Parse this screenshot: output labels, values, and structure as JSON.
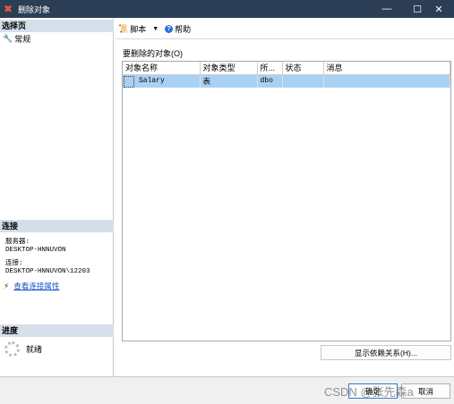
{
  "window": {
    "title": "删除对象",
    "icon": "delete-x-icon",
    "controls": [
      "—",
      "☐",
      "✕"
    ]
  },
  "left": {
    "select_page_header": "选择页",
    "pages": [
      {
        "label": "常规",
        "icon": "wrench-icon"
      }
    ],
    "connection_header": "连接",
    "server_label": "服务器:",
    "server_value": "DESKTOP-HNNUVON",
    "connection_label": "连接:",
    "connection_value": "DESKTOP-HNNUVON\\12203",
    "view_properties_link": "查看连接属性",
    "progress_header": "进度",
    "progress_status": "就绪"
  },
  "toolbar": {
    "script_label": "脚本",
    "help_label": "帮助"
  },
  "main": {
    "section_label": "要删除的对象(O)",
    "columns": [
      "对象名称",
      "对象类型",
      "所...",
      "状态",
      "消息"
    ],
    "rows": [
      {
        "name": "Salary",
        "type": "表",
        "owner": "dbo",
        "status": "",
        "message": ""
      }
    ],
    "show_dependencies_button": "显示依赖关系(H)..."
  },
  "footer": {
    "ok_label": "确定",
    "cancel_label": "取消"
  },
  "watermark": "CSDN @张先森a",
  "colors": {
    "titlebar": "#2c3e55",
    "section_header": "#d5dfe9",
    "selected_row": "#a9d1f3",
    "link": "#1a55c8"
  }
}
